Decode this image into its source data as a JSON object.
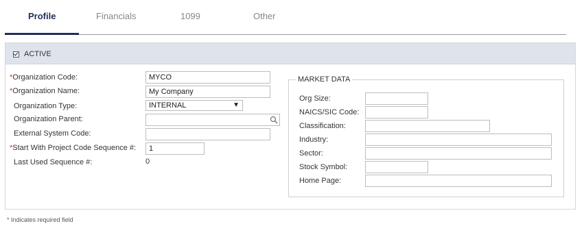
{
  "tabs": [
    {
      "label": "Profile",
      "active": true
    },
    {
      "label": "Financials",
      "active": false
    },
    {
      "label": "1099",
      "active": false
    },
    {
      "label": "Other",
      "active": false
    }
  ],
  "panel": {
    "active_label": "ACTIVE",
    "active_checked": true
  },
  "left_form": {
    "org_code": {
      "label": "Organization Code:",
      "required": true,
      "value": "MYCO"
    },
    "org_name": {
      "label": "Organization Name:",
      "required": true,
      "value": "My Company"
    },
    "org_type": {
      "label": "Organization Type:",
      "required": false,
      "value": "INTERNAL"
    },
    "org_parent": {
      "label": "Organization Parent:",
      "required": false,
      "value": ""
    },
    "external_code": {
      "label": "External System Code:",
      "required": false,
      "value": ""
    },
    "start_seq": {
      "label": "Start With Project Code Sequence #:",
      "required": true,
      "value": "1"
    },
    "last_seq": {
      "label": "Last Used Sequence #:",
      "required": false,
      "value": "0"
    }
  },
  "market_data": {
    "legend": "MARKET DATA",
    "fields": {
      "org_size": {
        "label": "Org Size:",
        "value": ""
      },
      "naics": {
        "label": "NAICS/SIC Code:",
        "value": ""
      },
      "classification": {
        "label": "Classification:",
        "value": ""
      },
      "industry": {
        "label": "Industry:",
        "value": ""
      },
      "sector": {
        "label": "Sector:",
        "value": ""
      },
      "stock_symbol": {
        "label": "Stock Symbol:",
        "value": ""
      },
      "home_page": {
        "label": "Home Page:",
        "value": ""
      }
    }
  },
  "footnote": {
    "asterisk": "*",
    "text": "Indicates required field"
  },
  "colors": {
    "accent": "#1f2f5a",
    "required": "#c0392b",
    "header_bg": "#dfe3ec"
  }
}
